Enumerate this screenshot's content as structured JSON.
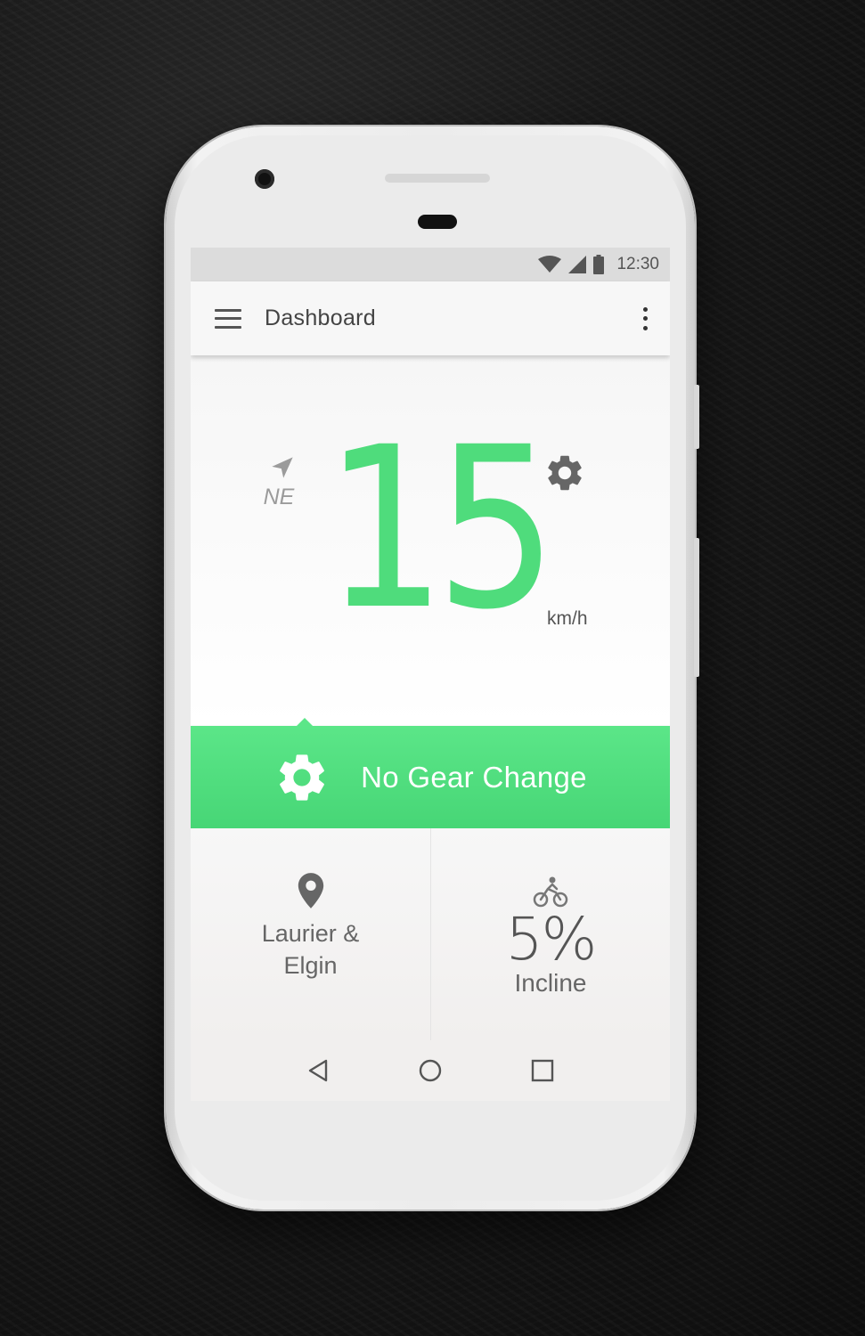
{
  "status_bar": {
    "time": "12:30"
  },
  "app_bar": {
    "title": "Dashboard"
  },
  "speed": {
    "heading": "NE",
    "value": "15",
    "unit": "km/h"
  },
  "gear_banner": {
    "label": "No Gear Change"
  },
  "location": {
    "line1": "Laurier &",
    "line2": "Elgin"
  },
  "incline": {
    "value": "5%",
    "label": "Incline"
  },
  "colors": {
    "accent": "#4fdc7c",
    "banner": "#52e080",
    "app_bar": "#f7f7f7",
    "status_bar": "#dcdcdc"
  },
  "icons": [
    "wifi-icon",
    "signal-icon",
    "battery-icon",
    "menu-icon",
    "more-vert-icon",
    "navigation-arrow-icon",
    "settings-icon",
    "location-pin-icon",
    "bike-icon",
    "back-icon",
    "home-icon",
    "recents-icon"
  ]
}
